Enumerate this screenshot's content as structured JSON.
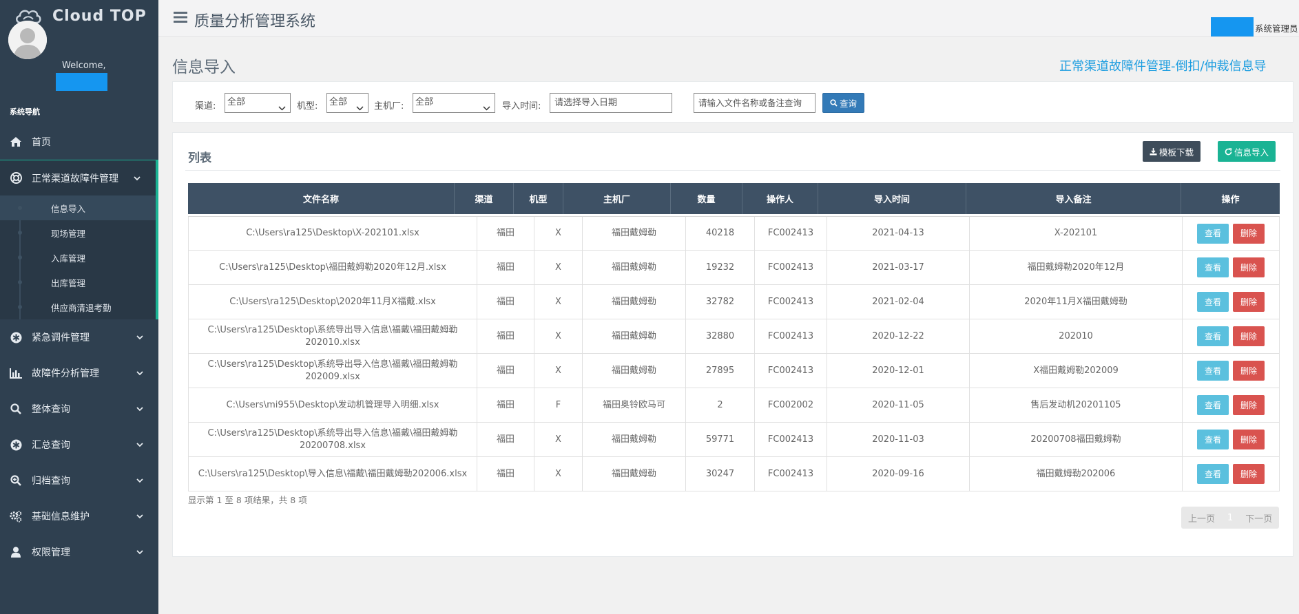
{
  "app": {
    "logo_text": "Cloud TOP",
    "system_title": "质量分析管理系统",
    "user_role": "系统管理员"
  },
  "sidebar": {
    "welcome": "Welcome,",
    "nav_title": "系统导航",
    "items": [
      {
        "label": "首页",
        "icon": "home-icon"
      },
      {
        "label": "正常渠道故障件管理",
        "icon": "lifebuoy-icon",
        "open": true,
        "children": [
          {
            "label": "信息导入",
            "active": true
          },
          {
            "label": "现场管理"
          },
          {
            "label": "入库管理"
          },
          {
            "label": "出库管理"
          },
          {
            "label": "供应商清退考勤"
          }
        ]
      },
      {
        "label": "紧急调件管理",
        "icon": "asterisk-icon"
      },
      {
        "label": "故障件分析管理",
        "icon": "bar-chart-icon"
      },
      {
        "label": "整体查询",
        "icon": "search-icon"
      },
      {
        "label": "汇总查询",
        "icon": "asterisk-icon"
      },
      {
        "label": "归档查询",
        "icon": "zoom-in-icon"
      },
      {
        "label": "基础信息维护",
        "icon": "gears-icon"
      },
      {
        "label": "权限管理",
        "icon": "user-icon"
      }
    ]
  },
  "page": {
    "title": "信息导入",
    "path": "正常渠道故障件管理-倒扣/仲裁信息导"
  },
  "search": {
    "channel_label": "渠道:",
    "channel_value": "全部",
    "model_label": "机型:",
    "model_value": "全部",
    "oem_label": "主机厂:",
    "oem_value": "全部",
    "date_label": "导入时间:",
    "date_placeholder": "请选择导入日期",
    "keyword_placeholder": "请输入文件名称或备注查询",
    "search_button": "查询"
  },
  "list": {
    "title": "列表",
    "template_button": "模板下载",
    "import_button": "信息导入",
    "columns": [
      "文件名称",
      "渠道",
      "机型",
      "主机厂",
      "数量",
      "操作人",
      "导入时间",
      "导入备注",
      "操作"
    ],
    "view_label": "查看",
    "delete_label": "删除",
    "rows": [
      [
        "C:\\Users\\ra125\\Desktop\\X-202101.xlsx",
        "福田",
        "X",
        "福田戴姆勒",
        "40218",
        "FC002413",
        "2021-04-13",
        "X-202101"
      ],
      [
        "C:\\Users\\ra125\\Desktop\\福田戴姆勒2020年12月.xlsx",
        "福田",
        "X",
        "福田戴姆勒",
        "19232",
        "FC002413",
        "2021-03-17",
        "福田戴姆勒2020年12月"
      ],
      [
        "C:\\Users\\ra125\\Desktop\\2020年11月X福戴.xlsx",
        "福田",
        "X",
        "福田戴姆勒",
        "32782",
        "FC002413",
        "2021-02-04",
        "2020年11月X福田戴姆勒"
      ],
      [
        "C:\\Users\\ra125\\Desktop\\系统导出导入信息\\福戴\\福田戴姆勒202010.xlsx",
        "福田",
        "X",
        "福田戴姆勒",
        "32880",
        "FC002413",
        "2020-12-22",
        "202010"
      ],
      [
        "C:\\Users\\ra125\\Desktop\\系统导出导入信息\\福戴\\福田戴姆勒202009.xlsx",
        "福田",
        "X",
        "福田戴姆勒",
        "27895",
        "FC002413",
        "2020-12-01",
        "X福田戴姆勒202009"
      ],
      [
        "C:\\Users\\mi955\\Desktop\\发动机管理导入明细.xlsx",
        "福田",
        "F",
        "福田奥铃欧马可",
        "2",
        "FC002002",
        "2020-11-05",
        "售后发动机20201105"
      ],
      [
        "C:\\Users\\ra125\\Desktop\\系统导出导入信息\\福戴\\福田戴姆勒20200708.xlsx",
        "福田",
        "X",
        "福田戴姆勒",
        "59771",
        "FC002413",
        "2020-11-03",
        "20200708福田戴姆勒"
      ],
      [
        "C:\\Users\\ra125\\Desktop\\导入信息\\福戴\\福田戴姆勒202006.xlsx",
        "福田",
        "X",
        "福田戴姆勒",
        "30247",
        "FC002413",
        "2020-09-16",
        "福田戴姆勒202006"
      ]
    ],
    "pager_info": "显示第 1 至 8 项结果，共 8 项",
    "prev": "上一页",
    "page": "1",
    "next": "下一页"
  },
  "colors": {
    "sidebar": "#2f4050",
    "accent_green": "#1ab394",
    "primary_blue": "#337ab7",
    "info": "#5bc0de",
    "danger": "#d9534f",
    "table_header": "#3e5165"
  }
}
